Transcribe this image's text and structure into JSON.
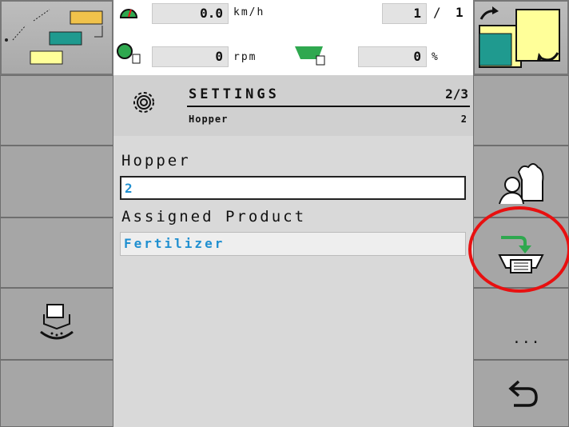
{
  "speed": {
    "value": "0.0",
    "unit": "km/h"
  },
  "rpm": {
    "value": "0",
    "unit": "rpm"
  },
  "percent": {
    "value": "0",
    "unit": "%"
  },
  "counter": {
    "left": "1",
    "separator": "/",
    "right": "1"
  },
  "header": {
    "title": "SETTINGS",
    "page": "2/3",
    "subtitle": "Hopper",
    "subtitle_value": "2"
  },
  "fields": {
    "hopper_label": "Hopper",
    "hopper_value": "2",
    "product_label": "Assigned Product",
    "product_value": "Fertilizer"
  },
  "right_more_label": "...",
  "colors": {
    "accent_text": "#1f8fd0",
    "highlight_circle": "#e81010",
    "tank_teal": "#1f9a8f",
    "tank_yellow": "#ffff99"
  },
  "icons": [
    "implement-layout-icon",
    "speedometer-icon",
    "fan-rpm-icon",
    "hopper-small-icon",
    "gear-icon",
    "tank-switch-icon",
    "operator-fertilizer-icon",
    "hopper-assign-icon",
    "meter-calibration-icon",
    "back-arrow-icon"
  ]
}
